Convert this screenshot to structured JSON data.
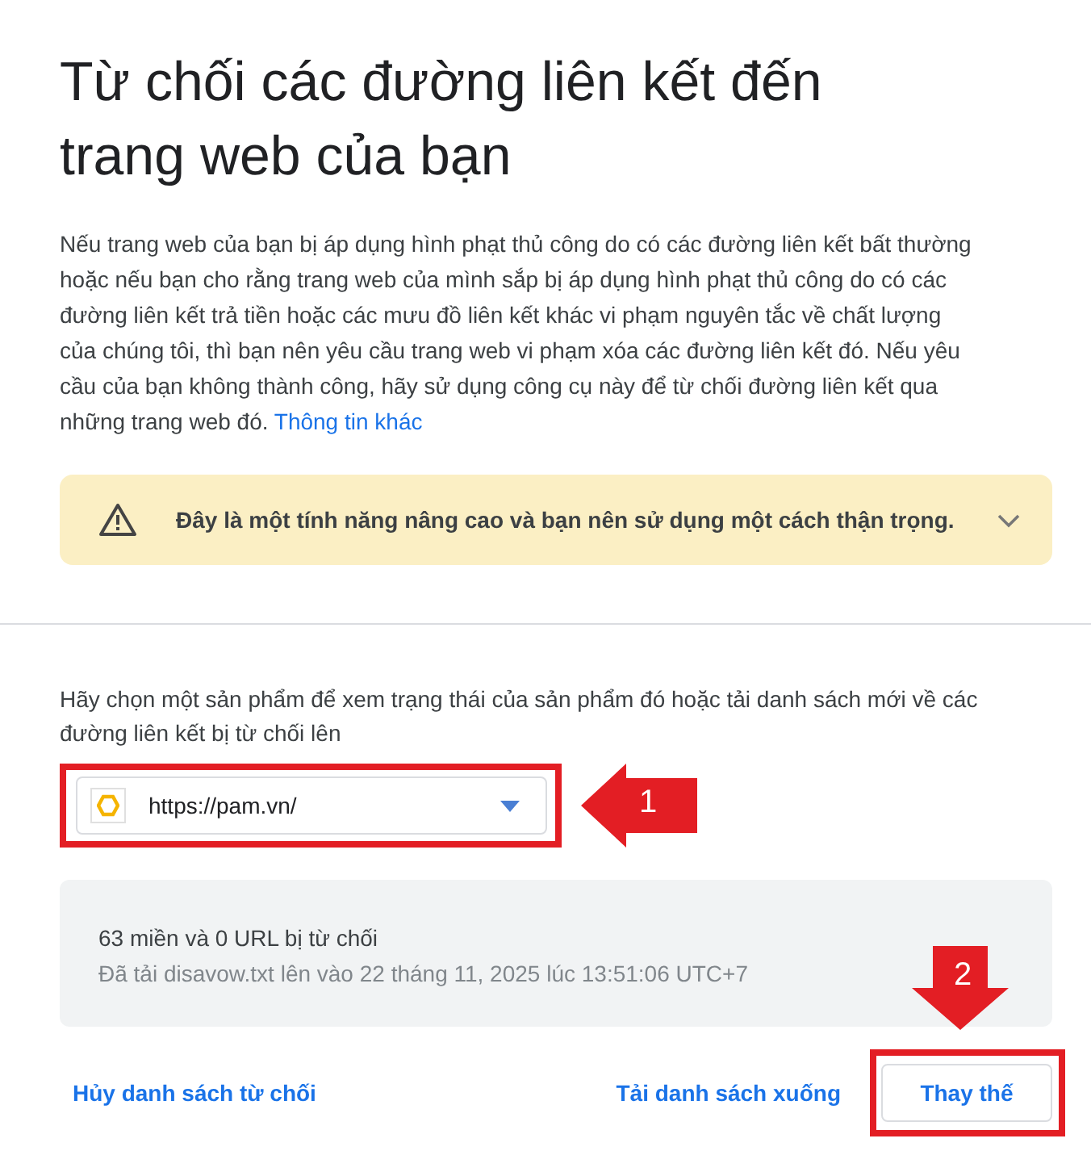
{
  "title": "Từ chối các đường liên kết đến trang web của bạn",
  "description": "Nếu trang web của bạn bị áp dụng hình phạt thủ công do có các đường liên kết bất thường hoặc nếu bạn cho rằng trang web của mình sắp bị áp dụng hình phạt thủ công do có các đường liên kết trả tiền hoặc các mưu đồ liên kết khác vi phạm nguyên tắc về chất lượng của chúng tôi, thì bạn nên yêu cầu trang web vi phạm xóa các đường liên kết đó. Nếu yêu cầu của bạn không thành công, hãy sử dụng công cụ này để từ chối đường liên kết qua những trang web đó.",
  "description_link": "Thông tin khác",
  "warning": {
    "text": "Đây là một tính năng nâng cao và bạn nên sử dụng một cách thận trọng.",
    "expanded": false
  },
  "prompt": "Hãy chọn một sản phẩm để xem trạng thái của sản phẩm đó hoặc tải danh sách mới về các đường liên kết bị từ chối lên",
  "property_select": {
    "value": "https://pam.vn/"
  },
  "status": {
    "summary": "63 miền và 0 URL bị từ chối",
    "detail": "Đã tải disavow.txt lên vào 22 tháng 11, 2025 lúc 13:51:06 UTC+7"
  },
  "actions": [
    {
      "label": "Hủy danh sách từ chối",
      "kind": "link"
    },
    {
      "label": "Tải danh sách xuống",
      "kind": "link"
    },
    {
      "label": "Thay thế",
      "kind": "outlined"
    }
  ],
  "annotations": [
    {
      "number": "1",
      "kind": "left"
    },
    {
      "number": "2",
      "kind": "down"
    }
  ]
}
